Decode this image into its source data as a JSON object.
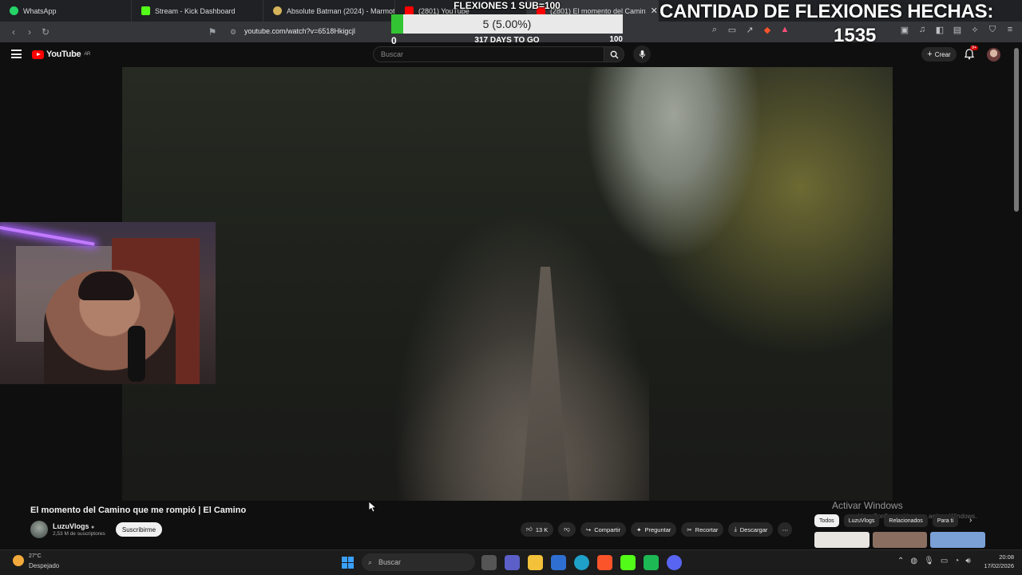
{
  "browser": {
    "tabs": [
      {
        "label": "WhatsApp",
        "color": "#25d366"
      },
      {
        "label": "Stream - Kick Dashboard",
        "color": "#53fc18"
      },
      {
        "label": "Absolute Batman (2024) - Marmota",
        "color": "#d4b35a"
      },
      {
        "label": "(2801) YouTube",
        "color": "#ff0000"
      },
      {
        "label": "(2801) El momento del Camin",
        "color": "#ff0000"
      }
    ],
    "url": "youtube.com/watch?v=6518Hkigcjl"
  },
  "overlay": {
    "goal_title": "FLEXIONES 1 SUB=100",
    "goal_count": "5 (5.00%)",
    "goal_progress": 0.05,
    "goal_min": "0",
    "goal_max": "100",
    "days_to_go": "317 DAYS TO GO",
    "pushups_title": "CANTIDAD DE FLEXIONES HECHAS:",
    "pushups_count": "1535"
  },
  "youtube": {
    "logo": "YouTube",
    "logo_country": "AR",
    "search_placeholder": "Buscar",
    "create_label": "Crear",
    "notif_badge": "9+"
  },
  "video": {
    "title": "El momento del Camino que me rompió | El Camino",
    "channel": "LuzuVlogs",
    "subscribers": "2,53 M de suscriptores",
    "subscribe_label": "Suscribirme",
    "likes": "13 K",
    "share_label": "Compartir",
    "ask_label": "Preguntar",
    "clip_label": "Recortar",
    "download_label": "Descargar"
  },
  "sidebar_chips": [
    "Todos",
    "LuzuVlogs",
    "Relacionados",
    "Para ti"
  ],
  "windows_watermark": {
    "line1": "Activar Windows",
    "line2": "Ve a Configuración para activar Windows."
  },
  "taskbar": {
    "temp": "27°C",
    "weather": "Despejado",
    "search_placeholder": "Buscar",
    "time": "20:08",
    "date": "17/02/2026"
  }
}
